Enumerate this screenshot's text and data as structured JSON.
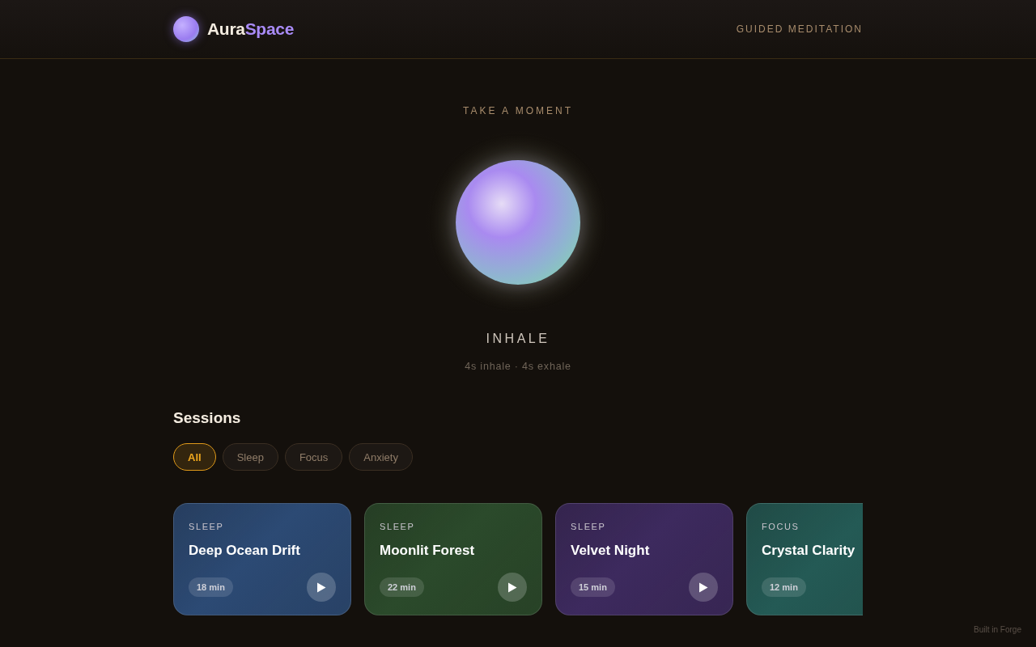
{
  "header": {
    "brand": {
      "first": "Aura",
      "second": "Space"
    },
    "nav_link": "GUIDED MEDITATION"
  },
  "breathing": {
    "eyebrow": "TAKE A MOMENT",
    "phase": "INHALE",
    "pattern": "4s inhale · 4s exhale"
  },
  "sessions": {
    "title": "Sessions",
    "filters": [
      {
        "label": "All",
        "selected": true
      },
      {
        "label": "Sleep",
        "selected": false
      },
      {
        "label": "Focus",
        "selected": false
      },
      {
        "label": "Anxiety",
        "selected": false
      }
    ],
    "cards": [
      {
        "category": "SLEEP",
        "title": "Deep Ocean Drift",
        "duration": "18 min",
        "color": "#2c4a74"
      },
      {
        "category": "SLEEP",
        "title": "Moonlit Forest",
        "duration": "22 min",
        "color": "#2b4a2b"
      },
      {
        "category": "SLEEP",
        "title": "Velvet Night",
        "duration": "15 min",
        "color": "#3d2a5e"
      },
      {
        "category": "FOCUS",
        "title": "Crystal Clarity",
        "duration": "12 min",
        "color": "#245a55"
      }
    ]
  },
  "footer": {
    "credit": "Built in Forge"
  }
}
